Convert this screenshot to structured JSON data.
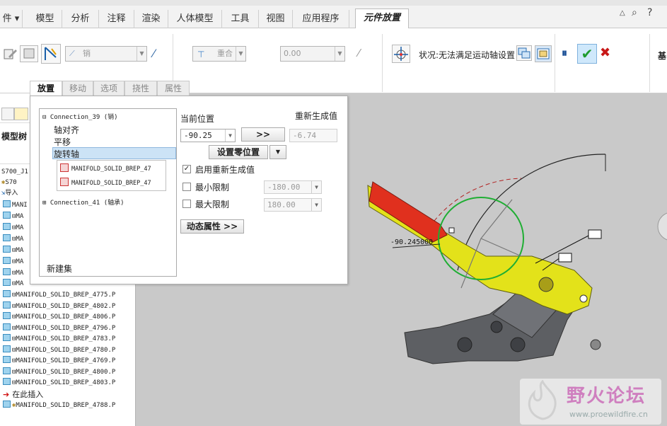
{
  "ribbon_tabs": [
    {
      "label": "件",
      "active": false
    },
    {
      "label": "模型",
      "active": false
    },
    {
      "label": "分析",
      "active": false
    },
    {
      "label": "注释",
      "active": false
    },
    {
      "label": "渲染",
      "active": false
    },
    {
      "label": "人体模型",
      "active": false
    },
    {
      "label": "工具",
      "active": false
    },
    {
      "label": "视图",
      "active": false
    },
    {
      "label": "应用程序",
      "active": false
    },
    {
      "label": "元件放置",
      "active": true
    }
  ],
  "ribbon": {
    "connection_type": "销",
    "constraint_type": "重合",
    "offset_value": "0.00",
    "status_text": "状况:无法满足运动轴设置",
    "right_label": "基"
  },
  "sub_tabs": [
    {
      "label": "放置",
      "active": true
    },
    {
      "label": "移动",
      "active": false
    },
    {
      "label": "选项",
      "active": false
    },
    {
      "label": "挠性",
      "active": false
    },
    {
      "label": "属性",
      "active": false
    }
  ],
  "panel": {
    "connections": {
      "conn1": "Connection_39 (销)",
      "item_axis": "轴对齐",
      "item_translate": "平移",
      "item_rotation": "旋转轴",
      "ref1": "MANIFOLD_SOLID_BREP_47",
      "ref2": "MANIFOLD_SOLID_BREP_47",
      "conn2": "Connection_41 (轴承)",
      "new_set": "新建集"
    },
    "current_position_label": "当前位置",
    "current_position_value": "-90.25",
    "regen_label": "重新生成值",
    "regen_value": "-6.74",
    "arrow_button": ">>",
    "set_zero_button": "设置零位置",
    "enable_regen_label": "启用重新生成值",
    "enable_regen_checked": true,
    "min_limit_label": "最小限制",
    "min_limit_value": "-180.00",
    "max_limit_label": "最大限制",
    "max_limit_value": "180.00",
    "dynamic_props_button": "动态属性 >>"
  },
  "tree": {
    "tab_label": "模型树",
    "top_items": [
      "S700_J1",
      "S70",
      "导入"
    ],
    "short_items": [
      "MANI",
      "MA",
      "MA",
      "MA",
      "MA",
      "MA",
      "MA",
      "MA"
    ],
    "items": [
      "MANIFOLD_SOLID_BREP_4775.P",
      "MANIFOLD_SOLID_BREP_4802.P",
      "MANIFOLD_SOLID_BREP_4806.P",
      "MANIFOLD_SOLID_BREP_4796.P",
      "MANIFOLD_SOLID_BREP_4783.P",
      "MANIFOLD_SOLID_BREP_4780.P",
      "MANIFOLD_SOLID_BREP_4769.P",
      "MANIFOLD_SOLID_BREP_4800.P",
      "MANIFOLD_SOLID_BREP_4803.P"
    ],
    "insert_here": "在此插入",
    "last_item": "MANIFOLD_SOLID_BREP_4788.P"
  },
  "viewport": {
    "angle_readout": "-90.245000",
    "watermark_cn": "野火论坛",
    "watermark_url": "www.proewildfire.cn"
  },
  "colors": {
    "yellow_part": "#e3e21a",
    "red_face": "#e0301e",
    "dark_part": "#5d5f63",
    "green_circle": "#1fae33",
    "confirm_green": "#1f9c2e",
    "cancel_red": "#c81818"
  }
}
